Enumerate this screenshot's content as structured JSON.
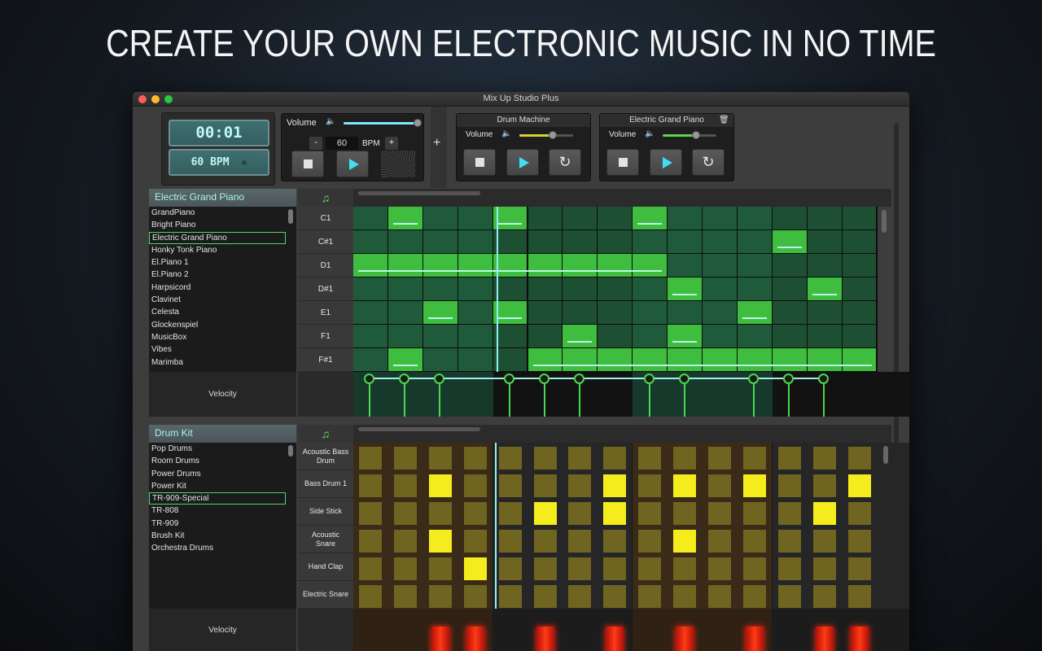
{
  "headline": "CREATE YOUR OWN ELECTRONIC MUSIC IN NO TIME",
  "window_title": "Mix Up Studio Plus",
  "transport": {
    "time": "00:01",
    "bpm_display": "60 BPM",
    "volume_label": "Volume",
    "volume_level": 0.95,
    "bpm_value": "60",
    "bpm_unit": "BPM",
    "minus_label": "-",
    "plus_label": "+",
    "add_track_label": "+"
  },
  "instruments": [
    {
      "name": "Drum Machine",
      "volume_label": "Volume",
      "volume_level": 0.62,
      "color": "#d9d23a"
    },
    {
      "name": "Electric Grand Piano",
      "volume_label": "Volume",
      "volume_level": 0.62,
      "color": "#5ed34c"
    }
  ],
  "piano_track": {
    "header": "Electric Grand Piano",
    "presets": [
      "GrandPiano",
      "Bright Piano",
      "Electric Grand Piano",
      "Honky Tonk Piano",
      "El.Piano 1",
      "El.Piano 2",
      "Harpsicord",
      "Clavinet",
      "Celesta",
      "Glockenspiel",
      "MusicBox",
      "Vibes",
      "Marimba"
    ],
    "selected_index": 2,
    "notes": [
      "C1",
      "C#1",
      "D1",
      "D#1",
      "E1",
      "F1",
      "F#1"
    ],
    "velocity_label": "Velocity",
    "note_events": [
      {
        "row": 0,
        "start": 1,
        "len": 1
      },
      {
        "row": 0,
        "start": 4,
        "len": 1
      },
      {
        "row": 0,
        "start": 8,
        "len": 1
      },
      {
        "row": 1,
        "start": 12,
        "len": 1
      },
      {
        "row": 2,
        "start": 0,
        "len": 9
      },
      {
        "row": 3,
        "start": 9,
        "len": 1
      },
      {
        "row": 3,
        "start": 13,
        "len": 1
      },
      {
        "row": 4,
        "start": 2,
        "len": 1
      },
      {
        "row": 4,
        "start": 4,
        "len": 1
      },
      {
        "row": 4,
        "start": 11,
        "len": 1
      },
      {
        "row": 5,
        "start": 6,
        "len": 1
      },
      {
        "row": 5,
        "start": 9,
        "len": 1
      },
      {
        "row": 6,
        "start": 1,
        "len": 1
      },
      {
        "row": 6,
        "start": 5,
        "len": 10
      }
    ],
    "velocity_steps": [
      0,
      1,
      2,
      4,
      5,
      6,
      8,
      9,
      11,
      12,
      13
    ]
  },
  "drum_track": {
    "header": "Drum Kit",
    "presets": [
      "Pop Drums",
      "Room Drums",
      "Power Drums",
      "Power Kit",
      "TR-909-Special",
      "TR-808",
      "TR-909",
      "Brush Kit",
      "Orchestra Drums"
    ],
    "selected_index": 4,
    "instruments": [
      "Acoustic Bass Drum",
      "Bass Drum 1",
      "Side Stick",
      "Acoustic Snare",
      "Hand Clap",
      "Electric Snare"
    ],
    "velocity_label": "Velocity",
    "active_cells": [
      {
        "row": 1,
        "step": 2
      },
      {
        "row": 1,
        "step": 7
      },
      {
        "row": 1,
        "step": 9
      },
      {
        "row": 1,
        "step": 11
      },
      {
        "row": 1,
        "step": 14
      },
      {
        "row": 2,
        "step": 5
      },
      {
        "row": 2,
        "step": 7
      },
      {
        "row": 2,
        "step": 13
      },
      {
        "row": 3,
        "step": 2
      },
      {
        "row": 3,
        "step": 9
      },
      {
        "row": 4,
        "step": 3
      }
    ],
    "velocity_steps": [
      2,
      3,
      5,
      7,
      9,
      11,
      13,
      14
    ]
  }
}
